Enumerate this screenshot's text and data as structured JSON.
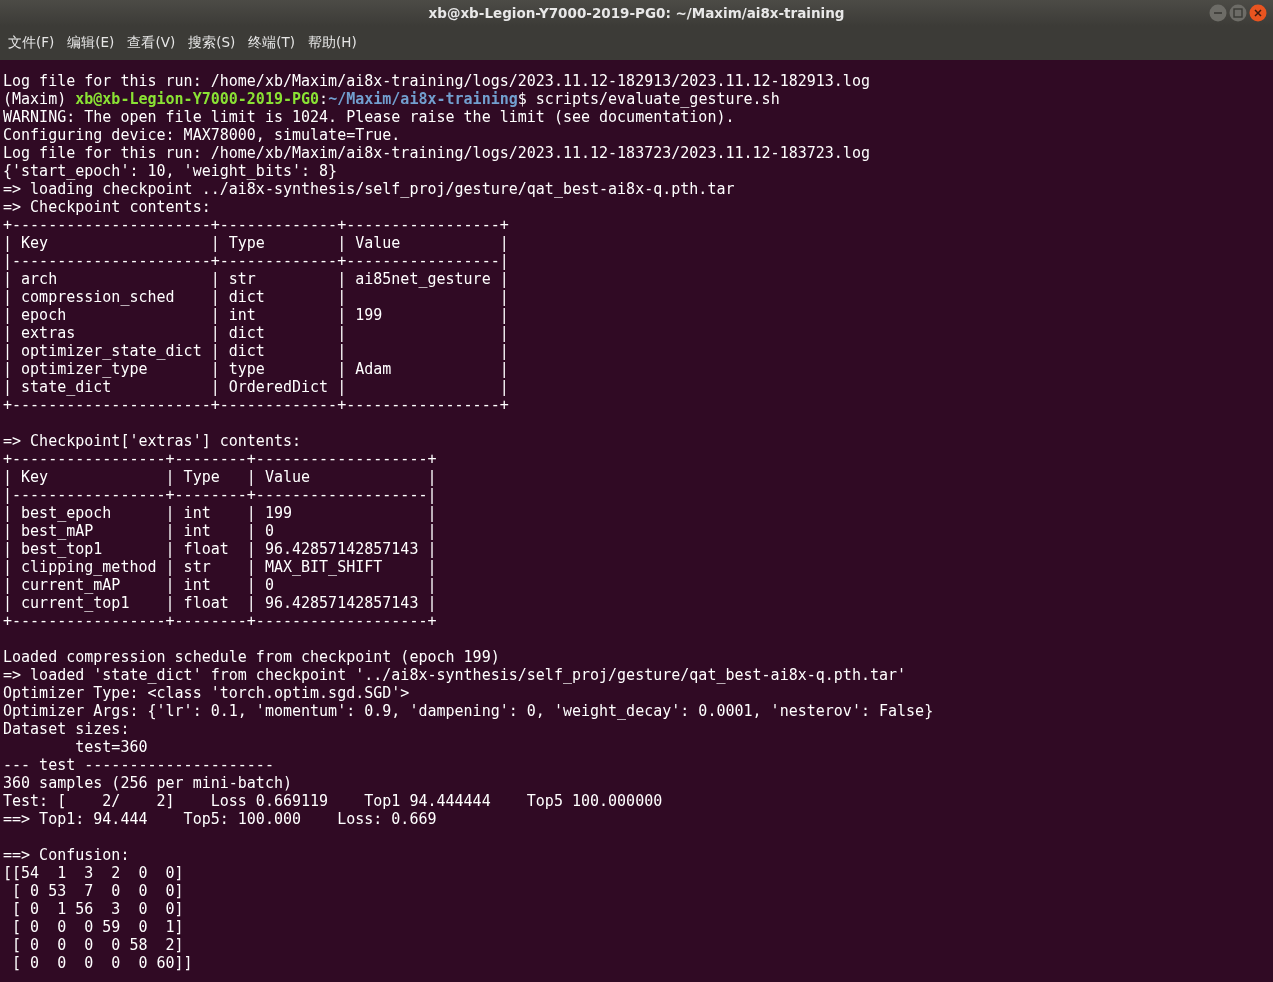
{
  "window": {
    "title": "xb@xb-Legion-Y7000-2019-PG0: ~/Maxim/ai8x-training"
  },
  "menu": [
    "文件(F)",
    "编辑(E)",
    "查看(V)",
    "搜索(S)",
    "终端(T)",
    "帮助(H)"
  ],
  "terminal": {
    "lines": [
      {
        "kind": "text",
        "text": "Log file for this run: /home/xb/Maxim/ai8x-training/logs/2023.11.12-182913/2023.11.12-182913.log"
      },
      {
        "kind": "prompt",
        "env": "(Maxim)",
        "user_host": "xb@xb-Legion-Y7000-2019-PG0",
        "separator": ":",
        "path": "~/Maxim/ai8x-training",
        "symbol": "$",
        "command": "scripts/evaluate_gesture.sh"
      },
      {
        "kind": "text",
        "text": "WARNING: The open file limit is 1024. Please raise the limit (see documentation)."
      },
      {
        "kind": "text",
        "text": "Configuring device: MAX78000, simulate=True."
      },
      {
        "kind": "text",
        "text": "Log file for this run: /home/xb/Maxim/ai8x-training/logs/2023.11.12-183723/2023.11.12-183723.log"
      },
      {
        "kind": "text",
        "text": "{'start_epoch': 10, 'weight_bits': 8}"
      },
      {
        "kind": "text",
        "text": "=> loading checkpoint ../ai8x-synthesis/self_proj/gesture/qat_best-ai8x-q.pth.tar"
      },
      {
        "kind": "text",
        "text": "=> Checkpoint contents:"
      },
      {
        "kind": "text",
        "text": "+----------------------+-------------+-----------------+"
      },
      {
        "kind": "text",
        "text": "| Key                  | Type        | Value           |"
      },
      {
        "kind": "text",
        "text": "|----------------------+-------------+-----------------|"
      },
      {
        "kind": "text",
        "text": "| arch                 | str         | ai85net_gesture |"
      },
      {
        "kind": "text",
        "text": "| compression_sched    | dict        |                 |"
      },
      {
        "kind": "text",
        "text": "| epoch                | int         | 199             |"
      },
      {
        "kind": "text",
        "text": "| extras               | dict        |                 |"
      },
      {
        "kind": "text",
        "text": "| optimizer_state_dict | dict        |                 |"
      },
      {
        "kind": "text",
        "text": "| optimizer_type       | type        | Adam            |"
      },
      {
        "kind": "text",
        "text": "| state_dict           | OrderedDict |                 |"
      },
      {
        "kind": "text",
        "text": "+----------------------+-------------+-----------------+"
      },
      {
        "kind": "blank"
      },
      {
        "kind": "text",
        "text": "=> Checkpoint['extras'] contents:"
      },
      {
        "kind": "text",
        "text": "+-----------------+--------+-------------------+"
      },
      {
        "kind": "text",
        "text": "| Key             | Type   | Value             |"
      },
      {
        "kind": "text",
        "text": "|-----------------+--------+-------------------|"
      },
      {
        "kind": "text",
        "text": "| best_epoch      | int    | 199               |"
      },
      {
        "kind": "text",
        "text": "| best_mAP        | int    | 0                 |"
      },
      {
        "kind": "text",
        "text": "| best_top1       | float  | 96.42857142857143 |"
      },
      {
        "kind": "text",
        "text": "| clipping_method | str    | MAX_BIT_SHIFT     |"
      },
      {
        "kind": "text",
        "text": "| current_mAP     | int    | 0                 |"
      },
      {
        "kind": "text",
        "text": "| current_top1    | float  | 96.42857142857143 |"
      },
      {
        "kind": "text",
        "text": "+-----------------+--------+-------------------+"
      },
      {
        "kind": "blank"
      },
      {
        "kind": "text",
        "text": "Loaded compression schedule from checkpoint (epoch 199)"
      },
      {
        "kind": "text",
        "text": "=> loaded 'state_dict' from checkpoint '../ai8x-synthesis/self_proj/gesture/qat_best-ai8x-q.pth.tar'"
      },
      {
        "kind": "text",
        "text": "Optimizer Type: <class 'torch.optim.sgd.SGD'>"
      },
      {
        "kind": "text",
        "text": "Optimizer Args: {'lr': 0.1, 'momentum': 0.9, 'dampening': 0, 'weight_decay': 0.0001, 'nesterov': False}"
      },
      {
        "kind": "text",
        "text": "Dataset sizes:"
      },
      {
        "kind": "text",
        "text": "        test=360"
      },
      {
        "kind": "text",
        "text": "--- test ---------------------"
      },
      {
        "kind": "text",
        "text": "360 samples (256 per mini-batch)"
      },
      {
        "kind": "text",
        "text": "Test: [    2/    2]    Loss 0.669119    Top1 94.444444    Top5 100.000000"
      },
      {
        "kind": "text",
        "text": "==> Top1: 94.444    Top5: 100.000    Loss: 0.669"
      },
      {
        "kind": "blank"
      },
      {
        "kind": "text",
        "text": "==> Confusion:"
      },
      {
        "kind": "text",
        "text": "[[54  1  3  2  0  0]"
      },
      {
        "kind": "text",
        "text": " [ 0 53  7  0  0  0]"
      },
      {
        "kind": "text",
        "text": " [ 0  1 56  3  0  0]"
      },
      {
        "kind": "text",
        "text": " [ 0  0  0 59  0  1]"
      },
      {
        "kind": "text",
        "text": " [ 0  0  0  0 58  2]"
      },
      {
        "kind": "text",
        "text": " [ 0  0  0  0  0 60]]"
      }
    ]
  }
}
